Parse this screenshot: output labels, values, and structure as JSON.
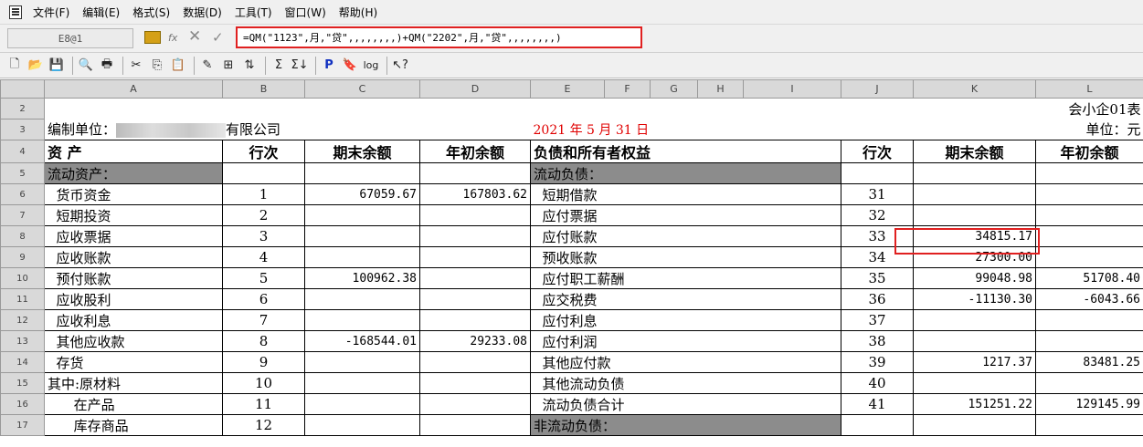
{
  "menu": [
    "文件(F)",
    "编辑(E)",
    "格式(S)",
    "数据(D)",
    "工具(T)",
    "窗口(W)",
    "帮助(H)"
  ],
  "formula_bar": {
    "cell_ref": "E8@1",
    "formula": "=QM(\"1123\",月,\"贷\",,,,,,,,)+QM(\"2202\",月,\"贷\",,,,,,,,)"
  },
  "columns": [
    "A",
    "B",
    "C",
    "D",
    "E",
    "F",
    "G",
    "H",
    "I",
    "J",
    "K",
    "L"
  ],
  "report": {
    "title_code": "会小企01表",
    "unit": "单位：元",
    "company_prefix": "编制单位：",
    "company_suffix": "有限公司",
    "date": "2021 年  5 月 31 日"
  },
  "headers": {
    "assets": "资  产",
    "row_no": "行次",
    "end_balance": "期末余额",
    "begin_balance": "年初余额",
    "liabilities": "负债和所有者权益",
    "row_no2": "行次",
    "end_balance2": "期末余额",
    "begin_balance2": "年初余额"
  },
  "rows": [
    {
      "r": "5",
      "a": "流动资产：",
      "b": "",
      "c": "",
      "d": "",
      "e": "流动负债：",
      "j": "",
      "k": "",
      "l": ""
    },
    {
      "r": "6",
      "a": "  货币资金",
      "b": "1",
      "c": "67059.67",
      "d": "167803.62",
      "e": "  短期借款",
      "j": "31",
      "k": "",
      "l": ""
    },
    {
      "r": "7",
      "a": "  短期投资",
      "b": "2",
      "c": "",
      "d": "",
      "e": "  应付票据",
      "j": "32",
      "k": "",
      "l": ""
    },
    {
      "r": "8",
      "a": "  应收票据",
      "b": "3",
      "c": "",
      "d": "",
      "e": "  应付账款",
      "j": "33",
      "k": "34815.17",
      "l": ""
    },
    {
      "r": "9",
      "a": "  应收账款",
      "b": "4",
      "c": "",
      "d": "",
      "e": "  预收账款",
      "j": "34",
      "k": "27300.00",
      "l": ""
    },
    {
      "r": "10",
      "a": "  预付账款",
      "b": "5",
      "c": "100962.38",
      "d": "",
      "e": "  应付职工薪酬",
      "j": "35",
      "k": "99048.98",
      "l": "51708.40"
    },
    {
      "r": "11",
      "a": "  应收股利",
      "b": "6",
      "c": "",
      "d": "",
      "e": "  应交税费",
      "j": "36",
      "k": "-11130.30",
      "l": "-6043.66"
    },
    {
      "r": "12",
      "a": "  应收利息",
      "b": "7",
      "c": "",
      "d": "",
      "e": "  应付利息",
      "j": "37",
      "k": "",
      "l": ""
    },
    {
      "r": "13",
      "a": "  其他应收款",
      "b": "8",
      "c": "-168544.01",
      "d": "29233.08",
      "e": "  应付利润",
      "j": "38",
      "k": "",
      "l": ""
    },
    {
      "r": "14",
      "a": "  存货",
      "b": "9",
      "c": "",
      "d": "",
      "e": "  其他应付款",
      "j": "39",
      "k": "1217.37",
      "l": "83481.25"
    },
    {
      "r": "15",
      "a": "其中:原材料",
      "b": "10",
      "c": "",
      "d": "",
      "e": "  其他流动负债",
      "j": "40",
      "k": "",
      "l": ""
    },
    {
      "r": "16",
      "a": "      在产品",
      "b": "11",
      "c": "",
      "d": "",
      "e": "  流动负债合计",
      "j": "41",
      "k": "151251.22",
      "l": "129145.99"
    },
    {
      "r": "17",
      "a": "      库存商品",
      "b": "12",
      "c": "",
      "d": "",
      "e": "非流动负债：",
      "j": "",
      "k": "",
      "l": ""
    }
  ],
  "colors": {
    "highlight": "#e02020",
    "date_text": "#e00000",
    "section_shade": "#8c8c8c"
  }
}
